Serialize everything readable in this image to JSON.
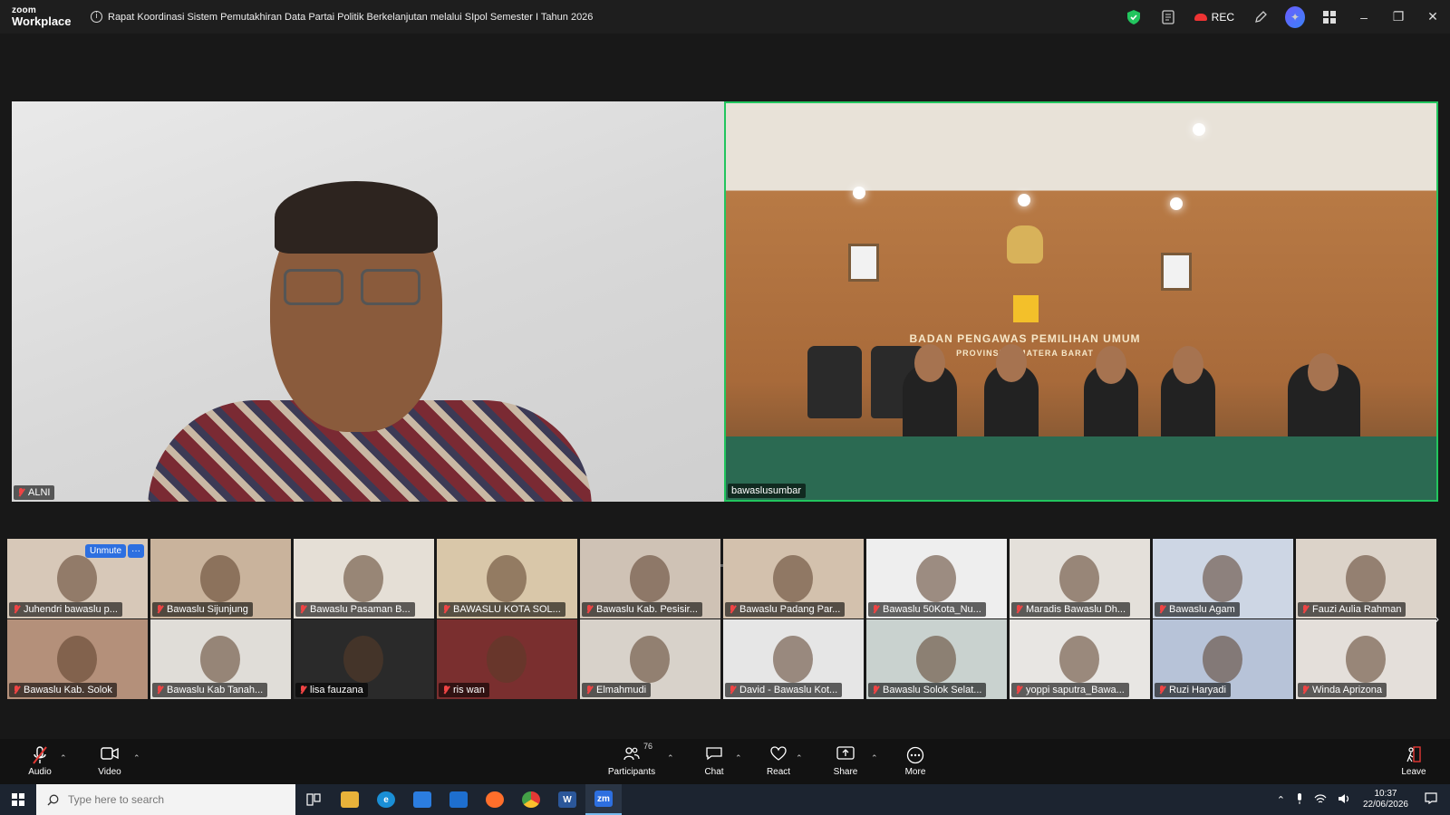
{
  "app": {
    "brand_small": "zoom",
    "brand_name": "Workplace"
  },
  "meeting": {
    "title": "Rapat Koordinasi Sistem Pemutakhiran Data Partai Politik Berkelanjutan melalui SIpol Semester I Tahun 2026"
  },
  "titlebar": {
    "rec_label": "REC",
    "icons": [
      "shield-icon",
      "notes-icon",
      "record-cloud-icon",
      "pencil-icon",
      "ai-companion-icon",
      "apps-grid-icon"
    ],
    "window_controls": [
      "minimize",
      "restore",
      "close"
    ]
  },
  "speakers": [
    {
      "name": "ALNI",
      "muted": true
    },
    {
      "name": "bawaslusumbar",
      "muted": false,
      "active_speaker": true
    }
  ],
  "room_sign": {
    "line1": "BADAN PENGAWAS PEMILIHAN UMUM",
    "line2": "PROVINSI SUMATERA BARAT"
  },
  "gallery": {
    "self_actions": {
      "unmute": "Unmute",
      "more": "···"
    },
    "tiles": [
      {
        "name": "Juhendri bawaslu p..."
      },
      {
        "name": "Bawaslu Sijunjung"
      },
      {
        "name": "Bawaslu Pasaman B..."
      },
      {
        "name": "BAWASLU KOTA SOL..."
      },
      {
        "name": "Bawaslu Kab. Pesisir..."
      },
      {
        "name": "Bawaslu Padang Par..."
      },
      {
        "name": "Bawaslu 50Kota_Nu..."
      },
      {
        "name": "Maradis Bawaslu Dh..."
      },
      {
        "name": "Bawaslu Agam"
      },
      {
        "name": "Fauzi Aulia Rahman"
      },
      {
        "name": "Bawaslu Kab. Solok"
      },
      {
        "name": "Bawaslu Kab Tanah..."
      },
      {
        "name": "lisa fauzana"
      },
      {
        "name": "ris wan"
      },
      {
        "name": "Elmahmudi"
      },
      {
        "name": "David - Bawaslu Kot..."
      },
      {
        "name": "Bawaslu Solok Selat..."
      },
      {
        "name": "yoppi saputra_Bawa..."
      },
      {
        "name": "Ruzi Haryadi"
      },
      {
        "name": "Winda Aprizona"
      }
    ]
  },
  "toolbar": {
    "audio": "Audio",
    "video": "Video",
    "participants": "Participants",
    "participants_count": "76",
    "chat": "Chat",
    "react": "React",
    "share": "Share",
    "more": "More",
    "leave": "Leave"
  },
  "taskbar": {
    "search_placeholder": "Type here to search",
    "time": "10:37",
    "date": "22/06/2026",
    "apps": [
      "task-view",
      "file-explorer",
      "edge",
      "store",
      "mail",
      "firefox",
      "chrome",
      "word",
      "zoom"
    ]
  },
  "colors": {
    "active_speaker_border": "#22c55e",
    "accent_blue": "#2d6fe0",
    "leave_red": "#e53935",
    "muted_red": "#e44444"
  }
}
